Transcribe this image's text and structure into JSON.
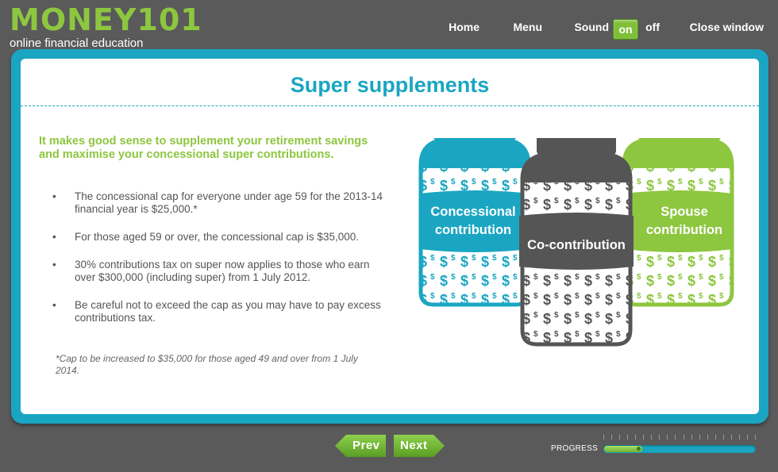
{
  "header": {
    "logo": "MONEY101",
    "tagline": "online financial education",
    "nav": {
      "home": "Home",
      "menu": "Menu",
      "sound": "Sound",
      "sound_on": "on",
      "sound_off": "off",
      "close": "Close window"
    }
  },
  "page": {
    "title": "Super supplements",
    "intro": "It makes good sense to supplement your retirement savings and maximise your concessional super contributions.",
    "bullets": [
      "The concessional cap for everyone under age 59 for the 2013-14 financial year is $25,000.*",
      "For those aged 59 or over, the concessional cap is $35,000.",
      "30% contributions tax on super now applies to those who earn over $300,000 (including super) from 1 July 2012.",
      "Be careful not to exceed the cap as you may have to pay excess contributions tax."
    ],
    "bullet_marker": "•",
    "footnote": "*Cap to be increased to $35,000 for those aged 49 and over from 1 July 2014."
  },
  "jars": [
    {
      "line1": "Concessional",
      "line2": "contribution",
      "color": "#1aa6c2"
    },
    {
      "line1": "Co-contribution",
      "line2": "",
      "color": "#555555"
    },
    {
      "line1": "Spouse",
      "line2": "contribution",
      "color": "#8dc63f"
    }
  ],
  "jar_symbol": "$",
  "footer": {
    "prev": "Prev",
    "next": "Next",
    "progress_label": "PROGRESS",
    "progress_fraction": 0.25
  },
  "colors": {
    "accent_blue": "#1aa6c2",
    "accent_green": "#8dc63f",
    "background": "#5a5a5a"
  }
}
